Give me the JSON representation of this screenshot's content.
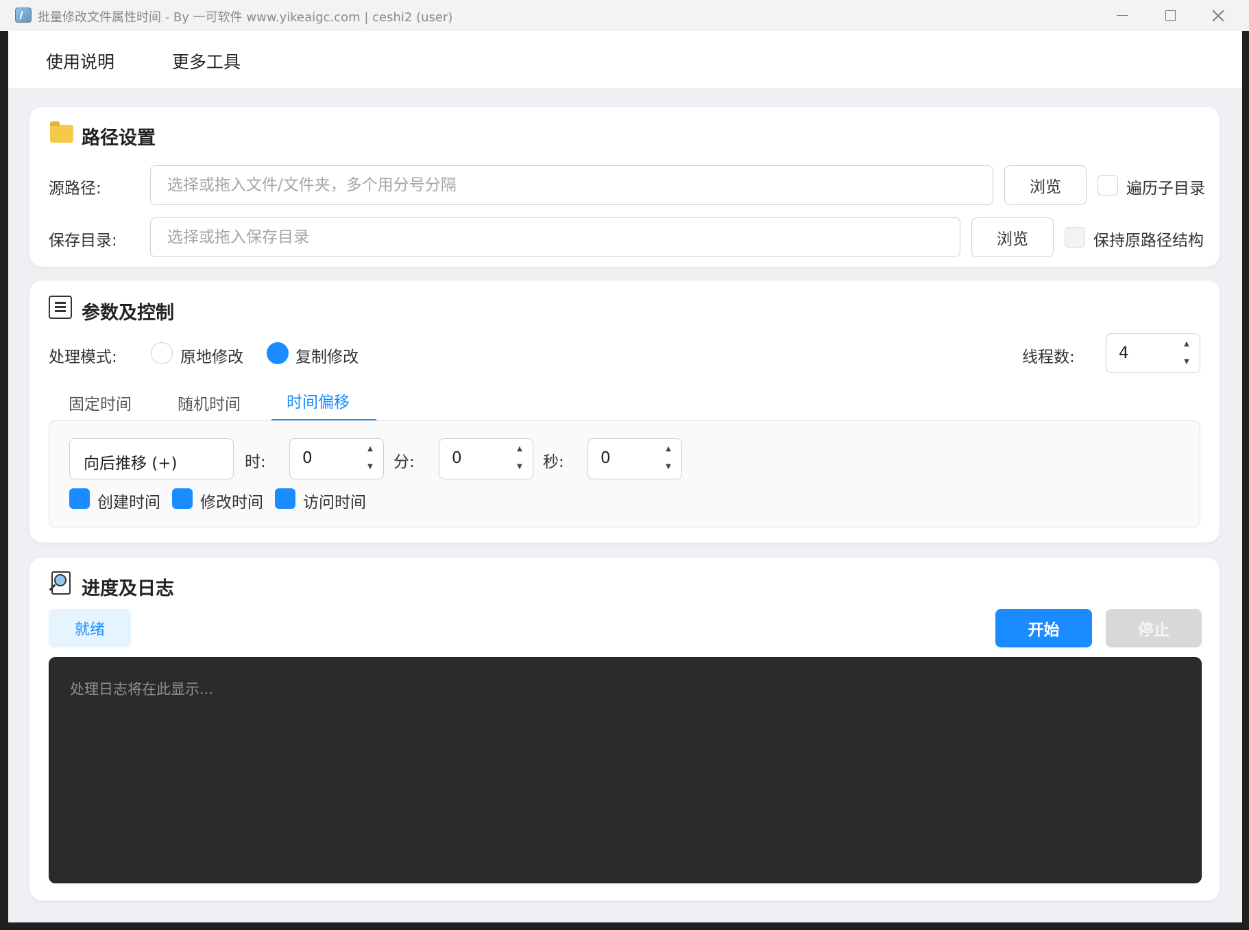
{
  "window": {
    "title": "批量修改文件属性时间 - By 一可软件 www.yikeaigc.com | ceshi2 (user)"
  },
  "menu": {
    "usage": "使用说明",
    "tools": "更多工具"
  },
  "path_settings": {
    "title": "路径设置",
    "source_label": "源路径:",
    "source_placeholder": "选择或拖入文件/文件夹，多个用分号分隔",
    "source_browse": "浏览",
    "recurse_label": "遍历子目录",
    "recurse_checked": false,
    "save_label": "保存目录:",
    "save_placeholder": "选择或拖入保存目录",
    "save_browse": "浏览",
    "keep_structure_label": "保持原路径结构",
    "keep_structure_checked": false
  },
  "params": {
    "title": "参数及控制",
    "mode_label": "处理模式:",
    "mode_inplace": "原地修改",
    "mode_copy": "复制修改",
    "mode_selected": "复制修改",
    "threads_label": "线程数:",
    "threads_value": "4",
    "tabs": [
      "固定时间",
      "随机时间",
      "时间偏移"
    ],
    "active_tab": "时间偏移",
    "offset": {
      "direction": "向后推移 (+)",
      "hours_label": "时:",
      "hours_value": "0",
      "minutes_label": "分:",
      "minutes_value": "0",
      "seconds_label": "秒:",
      "seconds_value": "0",
      "create_time": "创建时间",
      "modify_time": "修改时间",
      "access_time": "访问时间",
      "create_checked": true,
      "modify_checked": true,
      "access_checked": true
    }
  },
  "log": {
    "title": "进度及日志",
    "status": "就绪",
    "start": "开始",
    "stop": "停止",
    "placeholder": "处理日志将在此显示..."
  },
  "colors": {
    "accent": "#1a8cff",
    "log_bg": "#2b2b2b"
  }
}
